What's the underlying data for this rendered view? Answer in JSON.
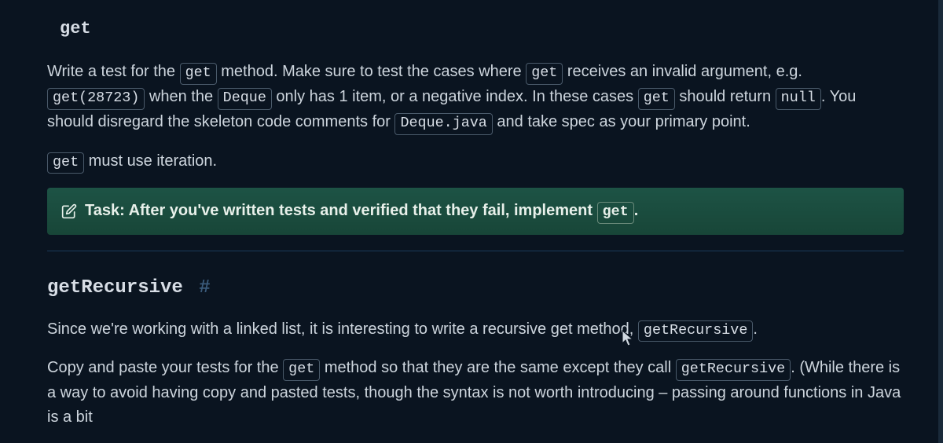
{
  "section1": {
    "title": "get",
    "p1_a": "Write a test for the ",
    "p1_code1": "get",
    "p1_b": " method. Make sure to test the cases where ",
    "p1_code2": "get",
    "p1_c": " receives an invalid argument, e.g. ",
    "p1_code3": "get(28723)",
    "p1_d": " when the ",
    "p1_code4": "Deque",
    "p1_e": " only has 1 item, or a negative index. In these cases ",
    "p1_code5": "get",
    "p1_f": " should return ",
    "p1_code6": "null",
    "p1_g": ". You should disregard the skeleton code comments for ",
    "p1_code7": "Deque.java",
    "p1_h": " and take spec as your primary point.",
    "p2_code": "get",
    "p2_text": " must use iteration.",
    "task_a": "Task: After you've written tests and verified that they fail, implement ",
    "task_code": "get",
    "task_b": "."
  },
  "section2": {
    "title": "getRecursive",
    "hash": "#",
    "p1_a": "Since we're working with a linked list, it is interesting to write a recursive get method, ",
    "p1_code1": "getRecursive",
    "p1_b": ".",
    "p2_a": "Copy and paste your tests for the ",
    "p2_code1": "get",
    "p2_b": " method so that they are the same except they call ",
    "p2_code2": "getRecursive",
    "p2_c": ". (While there is a way to avoid having copy and pasted tests, though the syntax is not worth introducing – passing around functions in Java is a bit"
  }
}
